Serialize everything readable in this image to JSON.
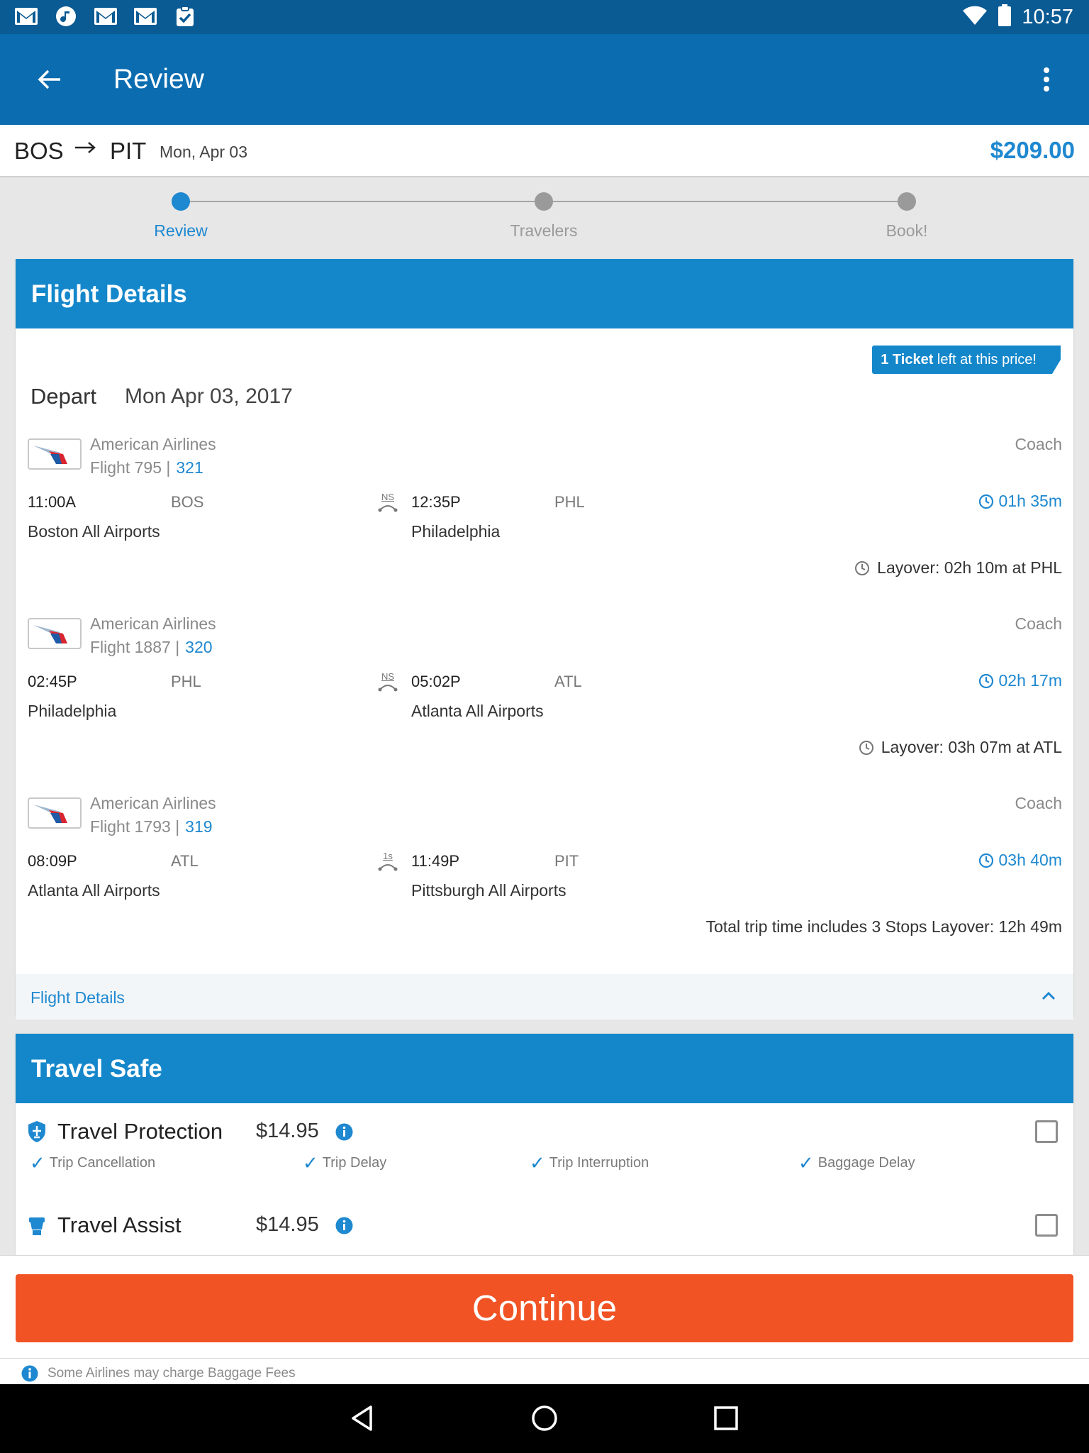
{
  "status_bar": {
    "time": "10:57",
    "notification_icons": [
      "gmail-icon",
      "music-icon",
      "gmail-icon",
      "gmail-icon",
      "clipboard-check-icon"
    ],
    "system_icons": [
      "wifi-icon",
      "battery-icon"
    ]
  },
  "appbar": {
    "title": "Review"
  },
  "route": {
    "from": "BOS",
    "to": "PIT",
    "date": "Mon, Apr 03",
    "price": "$209.00"
  },
  "steps": [
    {
      "label": "Review",
      "active": true
    },
    {
      "label": "Travelers",
      "active": false
    },
    {
      "label": "Book!",
      "active": false
    }
  ],
  "flight_details": {
    "header": "Flight Details",
    "badge_bold": "1 Ticket",
    "badge_rest": " left at this price!",
    "depart_label": "Depart",
    "depart_date": "Mon Apr 03, 2017",
    "segments": [
      {
        "airline": "American Airlines",
        "flight": "Flight 795 |",
        "aircraft": "321",
        "cabin": "Coach",
        "depart_time": "11:00A",
        "depart_code": "BOS",
        "depart_city": "Boston All Airports",
        "stop": "NS",
        "arrive_time": "12:35P",
        "arrive_code": "PHL",
        "arrive_city": "Philadelphia",
        "duration": "01h 35m",
        "layover": "Layover: 02h 10m at PHL"
      },
      {
        "airline": "American Airlines",
        "flight": "Flight 1887 |",
        "aircraft": "320",
        "cabin": "Coach",
        "depart_time": "02:45P",
        "depart_code": "PHL",
        "depart_city": "Philadelphia",
        "stop": "NS",
        "arrive_time": "05:02P",
        "arrive_code": "ATL",
        "arrive_city": "Atlanta All Airports",
        "duration": "02h 17m",
        "layover": "Layover: 03h 07m at ATL"
      },
      {
        "airline": "American Airlines",
        "flight": "Flight 1793 |",
        "aircraft": "319",
        "cabin": "Coach",
        "depart_time": "08:09P",
        "depart_code": "ATL",
        "depart_city": "Atlanta All Airports",
        "stop": "1s",
        "arrive_time": "11:49P",
        "arrive_code": "PIT",
        "arrive_city": "Pittsburgh All Airports",
        "duration": "03h 40m"
      }
    ],
    "total_trip": "Total trip time includes 3 Stops Layover: 12h 49m",
    "toggle_label": "Flight Details"
  },
  "travel_safe": {
    "header": "Travel Safe",
    "options": [
      {
        "name": "Travel Protection",
        "price": "$14.95",
        "checked": false
      },
      {
        "name": "Travel Assist",
        "price": "$14.95",
        "checked": false
      }
    ],
    "features": [
      "Trip Cancellation",
      "Trip Delay",
      "Trip Interruption",
      "Baggage Delay"
    ]
  },
  "continue_label": "Continue",
  "baggage_note": "Some Airlines may charge Baggage Fees",
  "colors": {
    "status_bar": "#0a5a93",
    "app_bar": "#0b6cb0",
    "card_header": "#1487cb",
    "accent": "#1e88d0",
    "continue": "#f15324"
  }
}
